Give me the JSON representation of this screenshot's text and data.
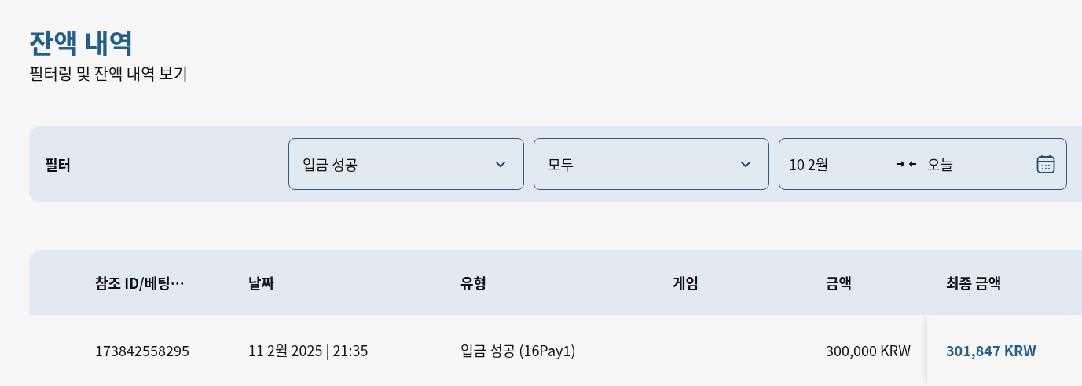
{
  "header": {
    "title": "잔액 내역",
    "subtitle": "필터링 및 잔액 내역 보기"
  },
  "filter": {
    "label": "필터",
    "selects": [
      {
        "value": "입금 성공"
      },
      {
        "value": "모두"
      }
    ],
    "date_range": {
      "from": "10 2월",
      "to": "오늘"
    }
  },
  "table": {
    "columns": [
      "참조 ID/베팅…",
      "날짜",
      "유형",
      "게임",
      "금액",
      "최종 금액"
    ],
    "rows": [
      {
        "cells": [
          "173842558295",
          "11 2월 2025 | 21:35",
          "입금 성공 (16Pay1)",
          "",
          "300,000 KRW",
          "301,847 KRW"
        ]
      }
    ]
  }
}
